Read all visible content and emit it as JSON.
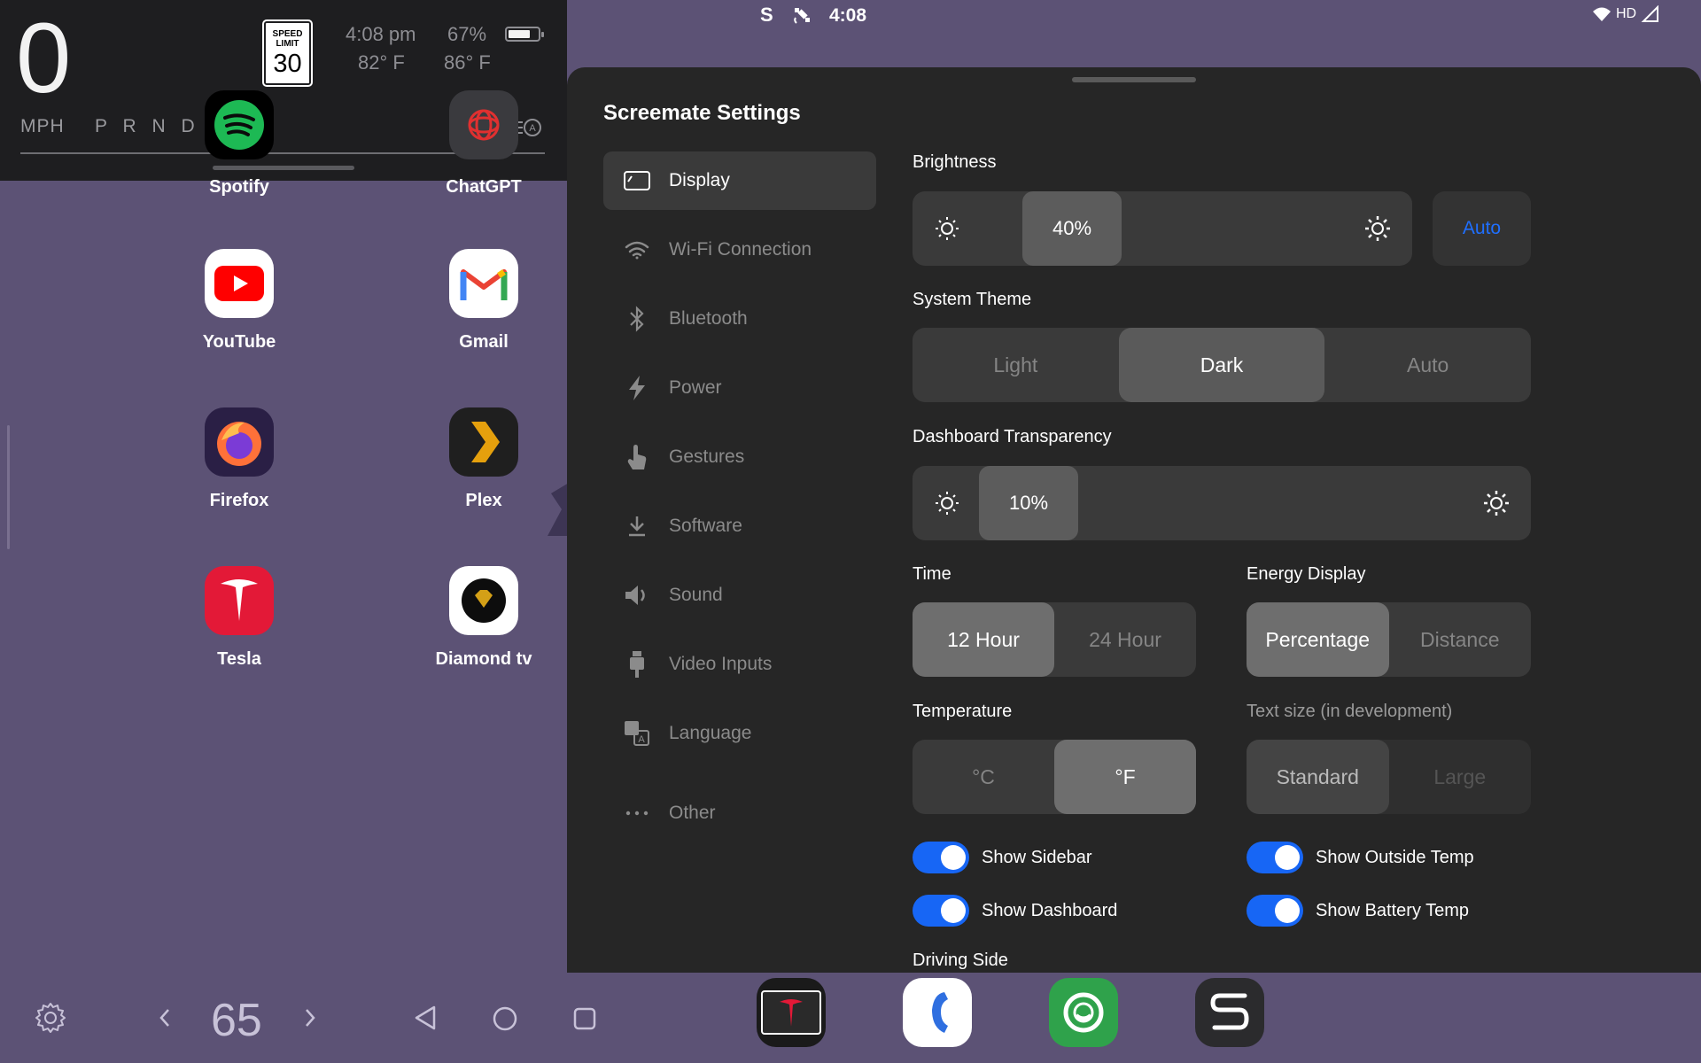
{
  "dashboard": {
    "speed": "0",
    "unit": "MPH",
    "gears": "P R N D",
    "speed_limit_label": "SPEED LIMIT",
    "speed_limit_value": "30",
    "time": "4:08 pm",
    "inside_temp": "82° F",
    "battery_percent": "67%",
    "outside_temp": "86° F",
    "battery_level": 0.67
  },
  "status_bar": {
    "time": "4:08",
    "network": "HD"
  },
  "apps": [
    {
      "label": "Spotify",
      "icon": "spotify-icon"
    },
    {
      "label": "ChatGPT",
      "icon": "chatgpt-icon"
    },
    {
      "label": "YouTube",
      "icon": "youtube-icon"
    },
    {
      "label": "Gmail",
      "icon": "gmail-icon"
    },
    {
      "label": "Firefox",
      "icon": "firefox-icon"
    },
    {
      "label": "Plex",
      "icon": "plex-icon"
    },
    {
      "label": "Tesla",
      "icon": "tesla-icon"
    },
    {
      "label": "Diamond tv",
      "icon": "diamond-tv-icon"
    }
  ],
  "settings": {
    "title": "Screemate Settings",
    "sidebar": [
      {
        "label": "Display",
        "icon": "display-icon",
        "active": true
      },
      {
        "label": "Wi-Fi Connection",
        "icon": "wifi-icon"
      },
      {
        "label": "Bluetooth",
        "icon": "bluetooth-icon"
      },
      {
        "label": "Power",
        "icon": "bolt-icon"
      },
      {
        "label": "Gestures",
        "icon": "hand-pointer-icon"
      },
      {
        "label": "Software",
        "icon": "download-icon"
      },
      {
        "label": "Sound",
        "icon": "speaker-icon"
      },
      {
        "label": "Video Inputs",
        "icon": "usb-plug-icon"
      },
      {
        "label": "Language",
        "icon": "translate-icon"
      },
      {
        "label": "Other",
        "icon": "ellipsis-icon"
      }
    ],
    "brightness": {
      "label": "Brightness",
      "value": "40%",
      "level": 0.4,
      "auto_label": "Auto"
    },
    "system_theme": {
      "label": "System Theme",
      "options": [
        "Light",
        "Dark",
        "Auto"
      ],
      "selected": "Dark"
    },
    "dashboard_transparency": {
      "label": "Dashboard Transparency",
      "value": "10%",
      "level": 0.1
    },
    "time": {
      "label": "Time",
      "options": [
        "12 Hour",
        "24 Hour"
      ],
      "selected": "12 Hour"
    },
    "energy_display": {
      "label": "Energy Display",
      "options": [
        "Percentage",
        "Distance"
      ],
      "selected": "Percentage"
    },
    "temperature": {
      "label": "Temperature",
      "options": [
        "°C",
        "°F"
      ],
      "selected": "°F"
    },
    "text_size": {
      "label": "Text size (in development)",
      "options": [
        "Standard",
        "Large"
      ],
      "selected": "Standard"
    },
    "toggles": {
      "show_sidebar": {
        "label": "Show Sidebar",
        "on": true
      },
      "show_dashboard": {
        "label": "Show Dashboard",
        "on": true
      },
      "show_outside_temp": {
        "label": "Show Outside Temp",
        "on": true
      },
      "show_battery_temp": {
        "label": "Show Battery Temp",
        "on": true
      }
    },
    "driving_side": {
      "label": "Driving Side"
    }
  },
  "bottom_nav": {
    "volume_value": "65"
  },
  "dock": [
    {
      "icon": "tesla-screen-icon"
    },
    {
      "icon": "phone-icon"
    },
    {
      "icon": "message-bubble-icon"
    },
    {
      "icon": "screemate-s-icon"
    }
  ],
  "colors": {
    "accent": "#1766f5",
    "wallpaper": "#5c5275",
    "panel": "#262626"
  }
}
